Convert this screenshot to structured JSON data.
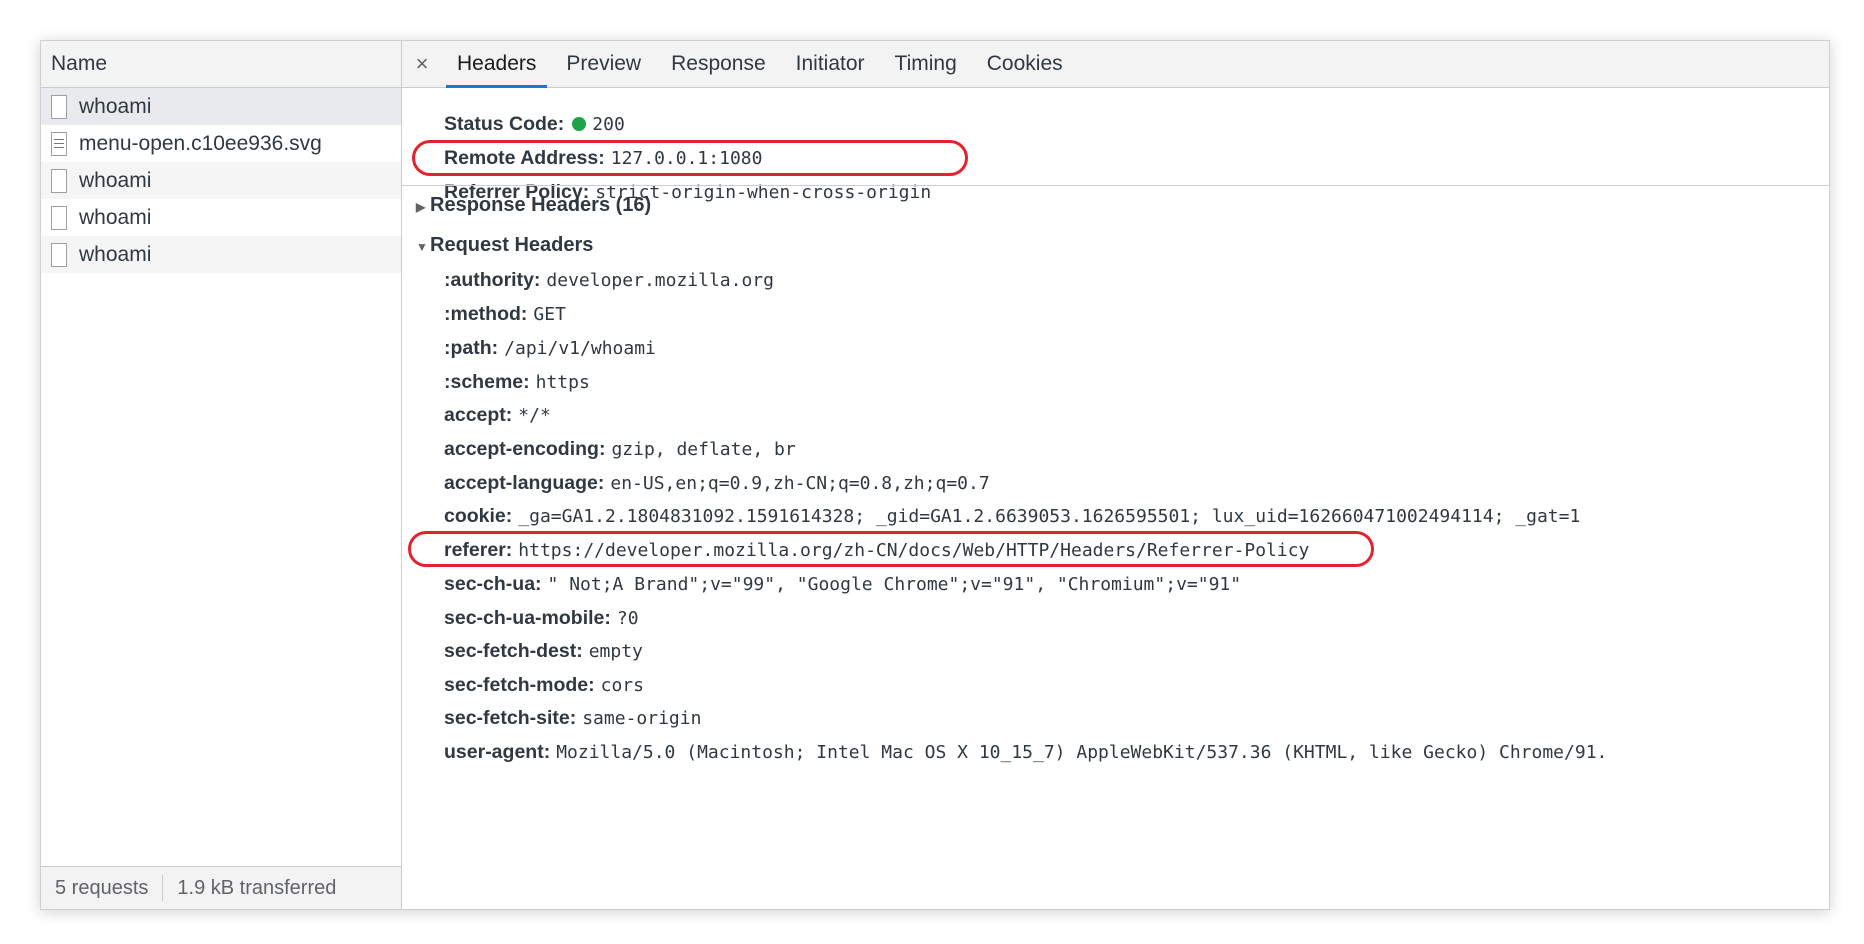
{
  "left": {
    "header": "Name",
    "requests": [
      {
        "name": "whoami",
        "icon": "blank-file-icon"
      },
      {
        "name": "menu-open.c10ee936.svg",
        "icon": "document-file-icon"
      },
      {
        "name": "whoami",
        "icon": "blank-file-icon"
      },
      {
        "name": "whoami",
        "icon": "blank-file-icon"
      },
      {
        "name": "whoami",
        "icon": "blank-file-icon"
      }
    ],
    "footer": {
      "requests": "5 requests",
      "transferred": "1.9 kB transferred"
    }
  },
  "tabs": {
    "close": "×",
    "items": [
      "Headers",
      "Preview",
      "Response",
      "Initiator",
      "Timing",
      "Cookies"
    ],
    "active": "Headers"
  },
  "general": {
    "status_label": "Status Code:",
    "status_value": "200",
    "status_color": "#1ea446",
    "remote_label": "Remote Address:",
    "remote_value": "127.0.0.1:1080",
    "referrer_label": "Referrer Policy:",
    "referrer_value": "strict-origin-when-cross-origin"
  },
  "response_headers": {
    "title": "Response Headers (16)",
    "expanded": false
  },
  "request_headers": {
    "title": "Request Headers",
    "expanded": true,
    "items": [
      {
        "k": ":authority:",
        "v": "developer.mozilla.org"
      },
      {
        "k": ":method:",
        "v": "GET"
      },
      {
        "k": ":path:",
        "v": "/api/v1/whoami"
      },
      {
        "k": ":scheme:",
        "v": "https"
      },
      {
        "k": "accept:",
        "v": "*/*"
      },
      {
        "k": "accept-encoding:",
        "v": "gzip, deflate, br"
      },
      {
        "k": "accept-language:",
        "v": "en-US,en;q=0.9,zh-CN;q=0.8,zh;q=0.7"
      },
      {
        "k": "cookie:",
        "v": "_ga=GA1.2.1804831092.1591614328; _gid=GA1.2.6639053.1626595501; lux_uid=162660471002494114; _gat=1"
      },
      {
        "k": "referer:",
        "v": "https://developer.mozilla.org/zh-CN/docs/Web/HTTP/Headers/Referrer-Policy"
      },
      {
        "k": "sec-ch-ua:",
        "v": "\" Not;A Brand\";v=\"99\", \"Google Chrome\";v=\"91\", \"Chromium\";v=\"91\""
      },
      {
        "k": "sec-ch-ua-mobile:",
        "v": "?0"
      },
      {
        "k": "sec-fetch-dest:",
        "v": "empty"
      },
      {
        "k": "sec-fetch-mode:",
        "v": "cors"
      },
      {
        "k": "sec-fetch-site:",
        "v": "same-origin"
      },
      {
        "k": "user-agent:",
        "v": "Mozilla/5.0 (Macintosh; Intel Mac OS X 10_15_7) AppleWebKit/537.36 (KHTML, like Gecko) Chrome/91."
      }
    ]
  },
  "highlight_color": "#e5212b"
}
